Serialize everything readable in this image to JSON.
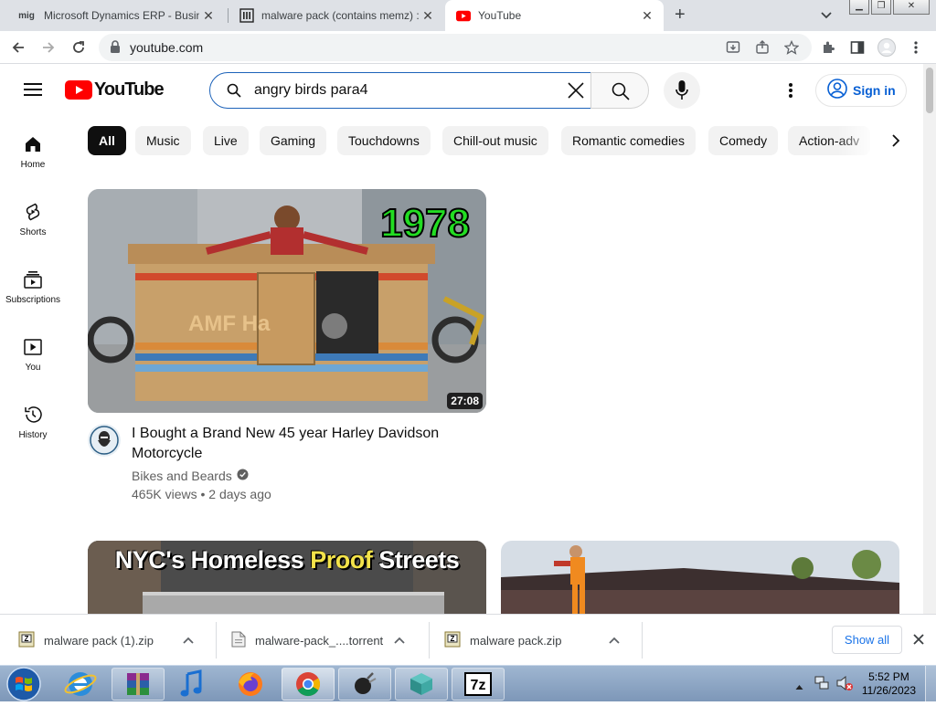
{
  "browser": {
    "tabs": [
      {
        "favicon": "mig",
        "title": "Microsoft Dynamics ERP - Busine"
      },
      {
        "favicon": "museum-icon",
        "title": "malware pack (contains memz) :"
      },
      {
        "favicon": "youtube-icon",
        "title": "YouTube"
      }
    ],
    "new_tab_label": "+",
    "url": "youtube.com"
  },
  "youtube": {
    "logo_text": "YouTube",
    "search": {
      "value": "angry birds para4"
    },
    "sign_in_label": "Sign in",
    "sidebar": [
      {
        "label": "Home",
        "icon": "home-icon"
      },
      {
        "label": "Shorts",
        "icon": "shorts-icon"
      },
      {
        "label": "Subscriptions",
        "icon": "subscriptions-icon"
      },
      {
        "label": "You",
        "icon": "you-icon"
      },
      {
        "label": "History",
        "icon": "history-icon"
      }
    ],
    "chips": [
      "All",
      "Music",
      "Live",
      "Gaming",
      "Touchdowns",
      "Chill-out music",
      "Romantic comedies",
      "Comedy",
      "Action-adv"
    ],
    "videos": [
      {
        "thumb_text": "1978",
        "duration": "27:08",
        "title": "I Bought a Brand New 45 year Harley Davidson Motorcycle",
        "channel": "Bikes and Beards",
        "meta": "465K views • 2 days ago"
      },
      {
        "thumb_text_a": "NYC's Homeless ",
        "thumb_text_b": "Proof",
        "thumb_text_c": " Streets"
      },
      {}
    ]
  },
  "downloads": {
    "items": [
      {
        "name": "malware pack (1).zip",
        "icon": "zip-file-icon"
      },
      {
        "name": "malware-pack_....torrent",
        "icon": "file-icon"
      },
      {
        "name": "malware pack.zip",
        "icon": "zip-file-icon"
      }
    ],
    "show_all_label": "Show all"
  },
  "taskbar": {
    "time": "5:52 PM",
    "date": "11/26/2023"
  },
  "colors": {
    "youtube_red": "#ff0000",
    "link_blue": "#065fd4",
    "chip_selected": "#0f0f0f"
  }
}
